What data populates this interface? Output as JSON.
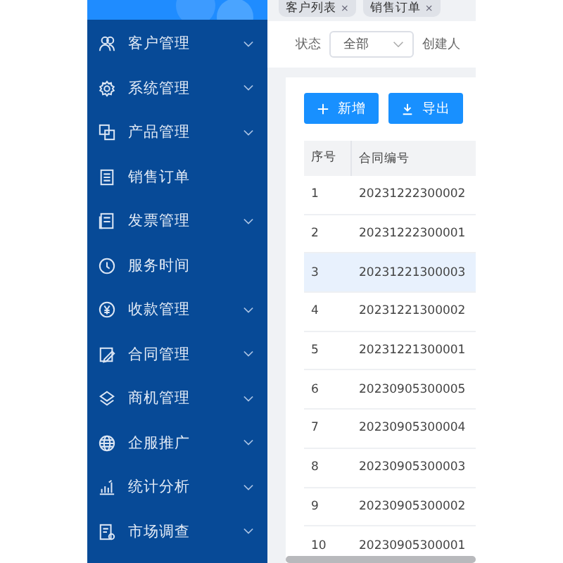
{
  "tabs": [
    {
      "label": "客户列表",
      "close": "×"
    },
    {
      "label": "销售订单",
      "close": "×"
    }
  ],
  "sidebar": {
    "items": [
      {
        "label": "客户管理",
        "has_children": true
      },
      {
        "label": "系统管理",
        "has_children": true
      },
      {
        "label": "产品管理",
        "has_children": true
      },
      {
        "label": "销售订单",
        "has_children": false
      },
      {
        "label": "发票管理",
        "has_children": true
      },
      {
        "label": "服务时间",
        "has_children": false
      },
      {
        "label": "收款管理",
        "has_children": true
      },
      {
        "label": "合同管理",
        "has_children": true
      },
      {
        "label": "商机管理",
        "has_children": true
      },
      {
        "label": "企服推广",
        "has_children": true
      },
      {
        "label": "统计分析",
        "has_children": true
      },
      {
        "label": "市场调查",
        "has_children": true
      }
    ]
  },
  "filters": {
    "status_label": "状态",
    "status_value": "全部",
    "creator_label": "创建人"
  },
  "buttons": [
    {
      "label": "新增",
      "kind": "add"
    },
    {
      "label": "导出",
      "kind": "export"
    }
  ],
  "table": {
    "columns": [
      "序号",
      "合同编号"
    ],
    "rows": [
      {
        "cells": [
          "1",
          "20231222300002"
        ],
        "highlighted": false
      },
      {
        "cells": [
          "2",
          "20231222300001"
        ],
        "highlighted": false
      },
      {
        "cells": [
          "3",
          "20231221300003"
        ],
        "highlighted": true
      },
      {
        "cells": [
          "4",
          "20231221300002"
        ],
        "highlighted": false
      },
      {
        "cells": [
          "5",
          "20231221300001"
        ],
        "highlighted": false
      },
      {
        "cells": [
          "6",
          "20230905300005"
        ],
        "highlighted": false
      },
      {
        "cells": [
          "7",
          "20230905300004"
        ],
        "highlighted": false
      },
      {
        "cells": [
          "8",
          "20230905300003"
        ],
        "highlighted": false
      },
      {
        "cells": [
          "9",
          "20230905300002"
        ],
        "highlighted": false
      },
      {
        "cells": [
          "10",
          "20230905300001"
        ],
        "highlighted": false
      }
    ]
  }
}
